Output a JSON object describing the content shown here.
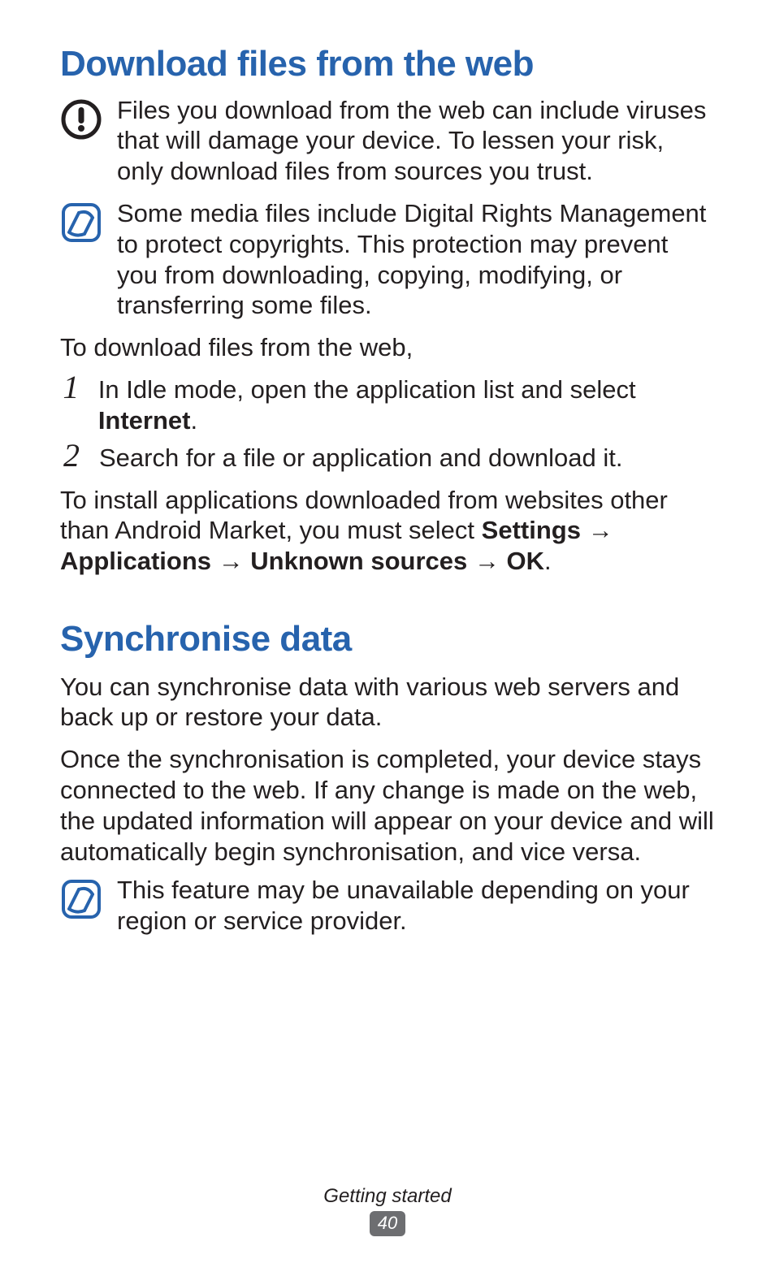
{
  "sections": {
    "download": {
      "heading": "Download files from the web",
      "warning": "Files you download from the web can include viruses that will damage your device. To lessen your risk, only download files from sources you trust.",
      "note": "Some media files include Digital Rights Management to protect copyrights. This protection may prevent you from downloading, copying, modifying, or transferring some files.",
      "intro": "To download files from the web,",
      "steps": [
        {
          "num": "1",
          "pre": "In Idle mode, open the application list and select ",
          "bold": "Internet",
          "post": "."
        },
        {
          "num": "2",
          "pre": "Search for a file or application and download it.",
          "bold": "",
          "post": ""
        }
      ],
      "install_pre": "To install applications downloaded from websites other than Android Market, you must select ",
      "install_b1": "Settings",
      "install_arrow1": " → ",
      "install_b2": "Applications",
      "install_arrow2": " → ",
      "install_b3": "Unknown sources",
      "install_arrow3": " → ",
      "install_b4": "OK",
      "install_post": "."
    },
    "sync": {
      "heading": "Synchronise data",
      "p1": "You can synchronise data with various web servers and back up or restore your data.",
      "p2": "Once the synchronisation is completed, your device stays connected to the web. If any change is made on the web, the updated information will appear on your device and will automatically begin synchronisation, and vice versa.",
      "note": "This feature may be unavailable depending on your region or service provider."
    }
  },
  "footer": {
    "chapter": "Getting started",
    "page": "40"
  },
  "colors": {
    "heading": "#2763ad",
    "body": "#231f20",
    "badge_bg": "#6d6e71",
    "note_stroke": "#2763ad",
    "warn_stroke": "#231f20"
  }
}
